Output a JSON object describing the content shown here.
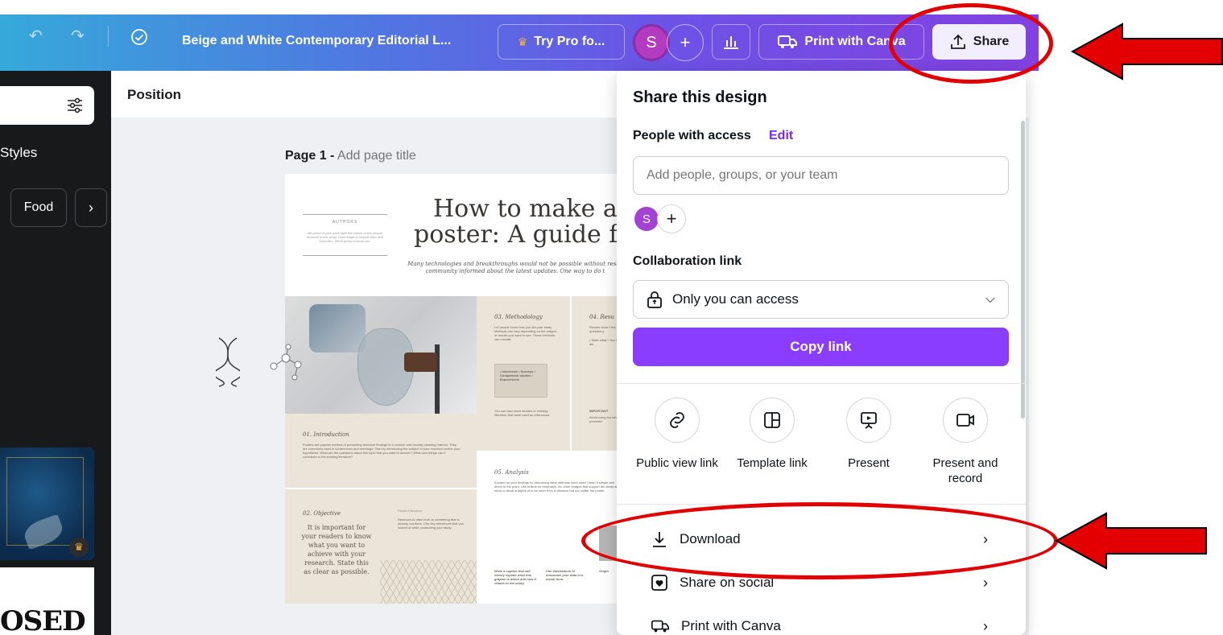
{
  "topbar": {
    "title": "Beige and White Contemporary Editorial L...",
    "try_pro": "Try Pro fo...",
    "avatar_initial": "S",
    "print_label": "Print with Canva",
    "share_label": "Share"
  },
  "left_panel": {
    "styles_label": "Styles",
    "chip_food": "Food",
    "thumb_text": "OSED"
  },
  "canvas": {
    "position_label": "Position",
    "page_number": "Page 1 -",
    "page_title_placeholder": "Add page title"
  },
  "poster": {
    "authors": "AUTHORS",
    "authors_desc": "Be proud of your work! Add the names of the people involved in this study. Don't forget to include titles and honorifics. We're proud of those too.",
    "title_line1": "How to make a r",
    "title_line2": "poster: A guide fo",
    "subtitle": "Many technologies and breakthroughs would not be possible without resea community informed about the latest updates. One way to do t",
    "methodology_title": "03. Methodology",
    "methodology_text": "Let people know how you did your study. Methods can vary depending on the subject or results you want to see. These methods can include:",
    "methodology_list": "• Interviews • Surveys • Comparison studies • Experiments",
    "methodology_more": "You can also show studies or existing literature that were used as references.",
    "results_title": "04. Resu",
    "results_text": "Results show t the question y",
    "results_bullets": "• State what • You can als",
    "important": "IMPORTANT",
    "important_text": "Avoid using too when presentin",
    "intro_title": "01. Introduction",
    "intro_text": "Posters are popular method of presenting research findings in a concise and visually pleasing manner. They are commonly used in conferences and meetings. Start by introducing the subject of your research and/or your hypothesis. What are the questions about this topic that you want to answer? What new things can it contribute to the existing literature?",
    "analysis_title": "05. Analysis",
    "analysis_text": "Expand on your findings by discussing what methods were used t keep it simple and direct to the point. Use bullets for emphasis. Inc other images that support the study and show a visual analysis of to be seen from a distance but not clutter the poster.",
    "objective_title": "02. Objective",
    "objective_text": "It is important for your readers to know what you want to achieve with your research. State this as clear as possible.",
    "related_title": "Related literature",
    "related_text": "Research is often built on something that is already out there. Cite key references that you looked at while conducting your study.",
    "caption1": "Write a caption that will clearly explain what this graphic is about and how it relates to the study.",
    "caption2": "Use illustrations to showcase your data in a visual form.",
    "caption3": "Graph"
  },
  "share_panel": {
    "title": "Share this design",
    "people_label": "People with access",
    "edit_label": "Edit",
    "input_placeholder": "Add people, groups, or your team",
    "avatar_initial": "S",
    "collab_label": "Collaboration link",
    "access_value": "Only you can access",
    "copy_label": "Copy link",
    "options": [
      {
        "label": "Public view link",
        "icon": "link-icon"
      },
      {
        "label": "Template link",
        "icon": "template-icon"
      },
      {
        "label": "Present",
        "icon": "present-icon"
      },
      {
        "label": "Present and record",
        "icon": "record-icon"
      }
    ],
    "rows": [
      {
        "label": "Download",
        "icon": "download-icon"
      },
      {
        "label": "Share on social",
        "icon": "heart-icon"
      },
      {
        "label": "Print with Canva",
        "icon": "truck-icon"
      }
    ]
  },
  "annotation_color": "#e30000",
  "accent_color": "#8b3dff"
}
